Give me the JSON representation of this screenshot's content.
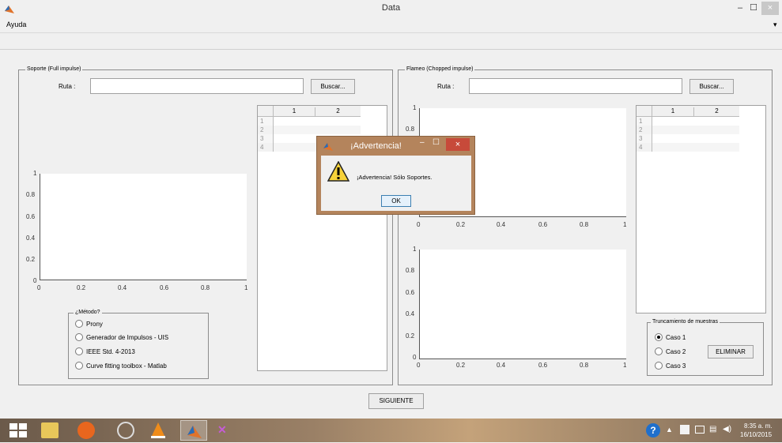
{
  "window": {
    "title": "Data",
    "minimize": "–",
    "maximize": "☐",
    "close": "×"
  },
  "menu": {
    "ayuda": "Ayuda",
    "arrow": "▾"
  },
  "soporte": {
    "title": "Soporte (Full impulse)",
    "ruta_label": "Ruta :",
    "ruta_value": "",
    "buscar": "Buscar...",
    "table_headers": [
      "1",
      "2"
    ],
    "table_rows": [
      "1",
      "2",
      "3",
      "4"
    ],
    "axes": {
      "xticks": [
        "0",
        "0.2",
        "0.4",
        "0.6",
        "0.8",
        "1"
      ],
      "yticks": [
        "0",
        "0.2",
        "0.4",
        "0.6",
        "0.8",
        "1"
      ]
    },
    "metodo": {
      "title": "¿Método?",
      "options": [
        "Prony",
        "Generador de Impulsos - UIS",
        "IEEE Std. 4-2013",
        "Curve fitting toolbox - Matlab"
      ]
    }
  },
  "flameo": {
    "title": "Flameo (Chopped impulse)",
    "ruta_label": "Ruta :",
    "ruta_value": "",
    "buscar": "Buscar...",
    "table_headers": [
      "1",
      "2"
    ],
    "table_rows": [
      "1",
      "2",
      "3",
      "4"
    ],
    "axes_top": {
      "xticks": [
        "0",
        "0.2",
        "0.4",
        "0.6",
        "0.8",
        "1"
      ],
      "yticks": [
        "0.8",
        "1"
      ]
    },
    "axes_bottom": {
      "xticks": [
        "0",
        "0.2",
        "0.4",
        "0.6",
        "0.8",
        "1"
      ],
      "yticks": [
        "0",
        "0.2",
        "0.4",
        "0.6",
        "0.8",
        "1"
      ]
    },
    "truncamiento": {
      "title": "Truncamiento de muestras",
      "options": [
        "Caso 1",
        "Caso 2",
        "Caso 3"
      ],
      "selected": "Caso 1",
      "eliminar": "ELIMINAR"
    }
  },
  "siguiente": "SIGUIENTE",
  "dialog": {
    "title": "¡Advertencia!",
    "message": "¡Advertencia! Sólo Soportes.",
    "ok": "OK",
    "icon": "warning-icon"
  },
  "taskbar": {
    "time": "8:35 a. m.",
    "date": "16/10/2015"
  }
}
